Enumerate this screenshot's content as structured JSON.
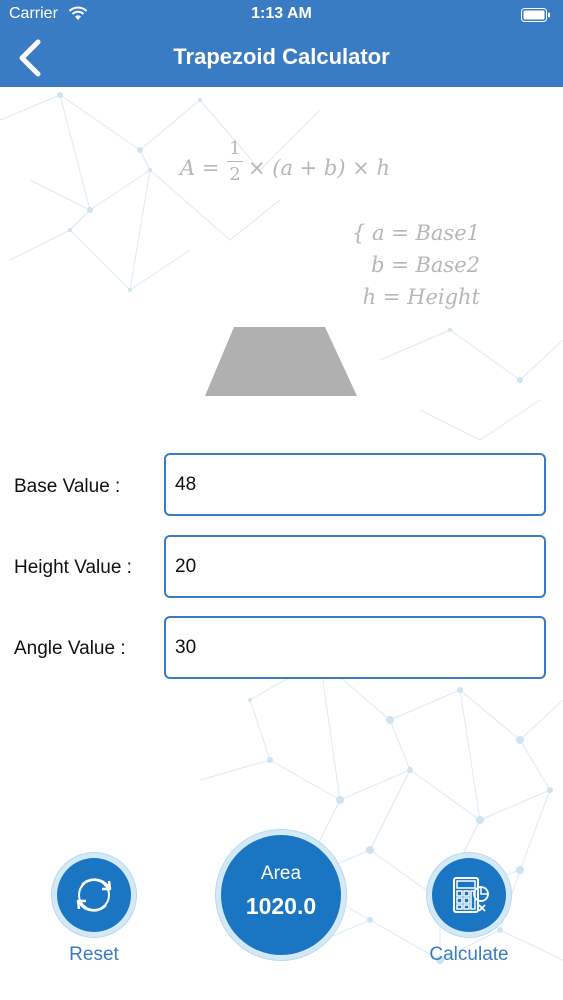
{
  "status_bar": {
    "carrier": "Carrier",
    "time": "1:13 AM"
  },
  "nav": {
    "title": "Trapezoid Calculator"
  },
  "formula": {
    "lhs": "A =",
    "frac_num": "1",
    "frac_den": "2",
    "rhs": "× (a + b) × h",
    "legend": [
      "{  a = Base1",
      "b = Base2",
      "h = Height"
    ]
  },
  "fields": [
    {
      "label": "Base Value :",
      "value": "48"
    },
    {
      "label": "Height Value :",
      "value": "20"
    },
    {
      "label": "Angle Value :",
      "value": "30"
    }
  ],
  "result": {
    "label": "Area",
    "value": "1020.0"
  },
  "buttons": {
    "reset_label": "Reset",
    "calculate_label": "Calculate"
  },
  "colors": {
    "primary": "#3a7cc4",
    "button": "#1a76c2",
    "shape": "#b0b0b0"
  },
  "icons": {
    "back": "chevron-left-icon",
    "reset": "refresh-icon",
    "calculate": "calculator-icon"
  }
}
